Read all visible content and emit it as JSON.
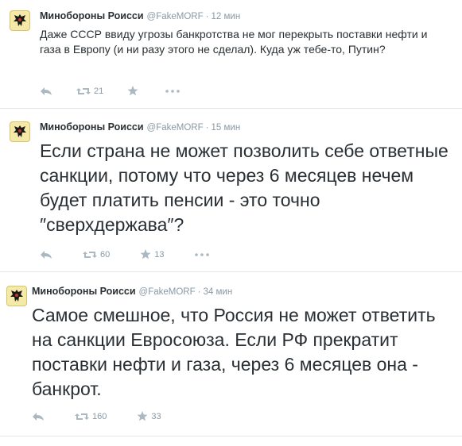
{
  "tweets": [
    {
      "name": "Минобороны Роисси",
      "handle": "@FakeMORF",
      "separator": "·",
      "time": "12 мин",
      "text": "Даже СССР ввиду угрозы банкротства не мог перекрыть поставки нефти и газа в Европу (и ни разу этого не сделал). Куда уж тебе-то, Путин?",
      "retweets": "21",
      "favorites": ""
    },
    {
      "name": "Минобороны Роисси",
      "handle": "@FakeMORF",
      "separator": "·",
      "time": "15 мин",
      "text": "Если страна не может позволить себе ответные санкции, потому что через 6 месяцев нечем будет платить пенсии - это точно ″сверхдержава″?",
      "retweets": "60",
      "favorites": "13"
    },
    {
      "name": "Минобороны Роисси",
      "handle": "@FakeMORF",
      "separator": "·",
      "time": "34 мин",
      "text": "Самое смешное, что Россия не может ответить на санкции Евросоюза. Если РФ прекратит поставки нефти и газа, через 6 месяцев она - банкрот.",
      "retweets": "160",
      "favorites": "33"
    }
  ],
  "colors": {
    "text": "#292f33",
    "muted": "#8899a6",
    "icon": "#aab8c2",
    "divider": "#e1e8ed"
  },
  "icons": [
    "eagle-avatar-icon",
    "reply-icon",
    "retweet-icon",
    "favorite-icon",
    "more-icon"
  ]
}
